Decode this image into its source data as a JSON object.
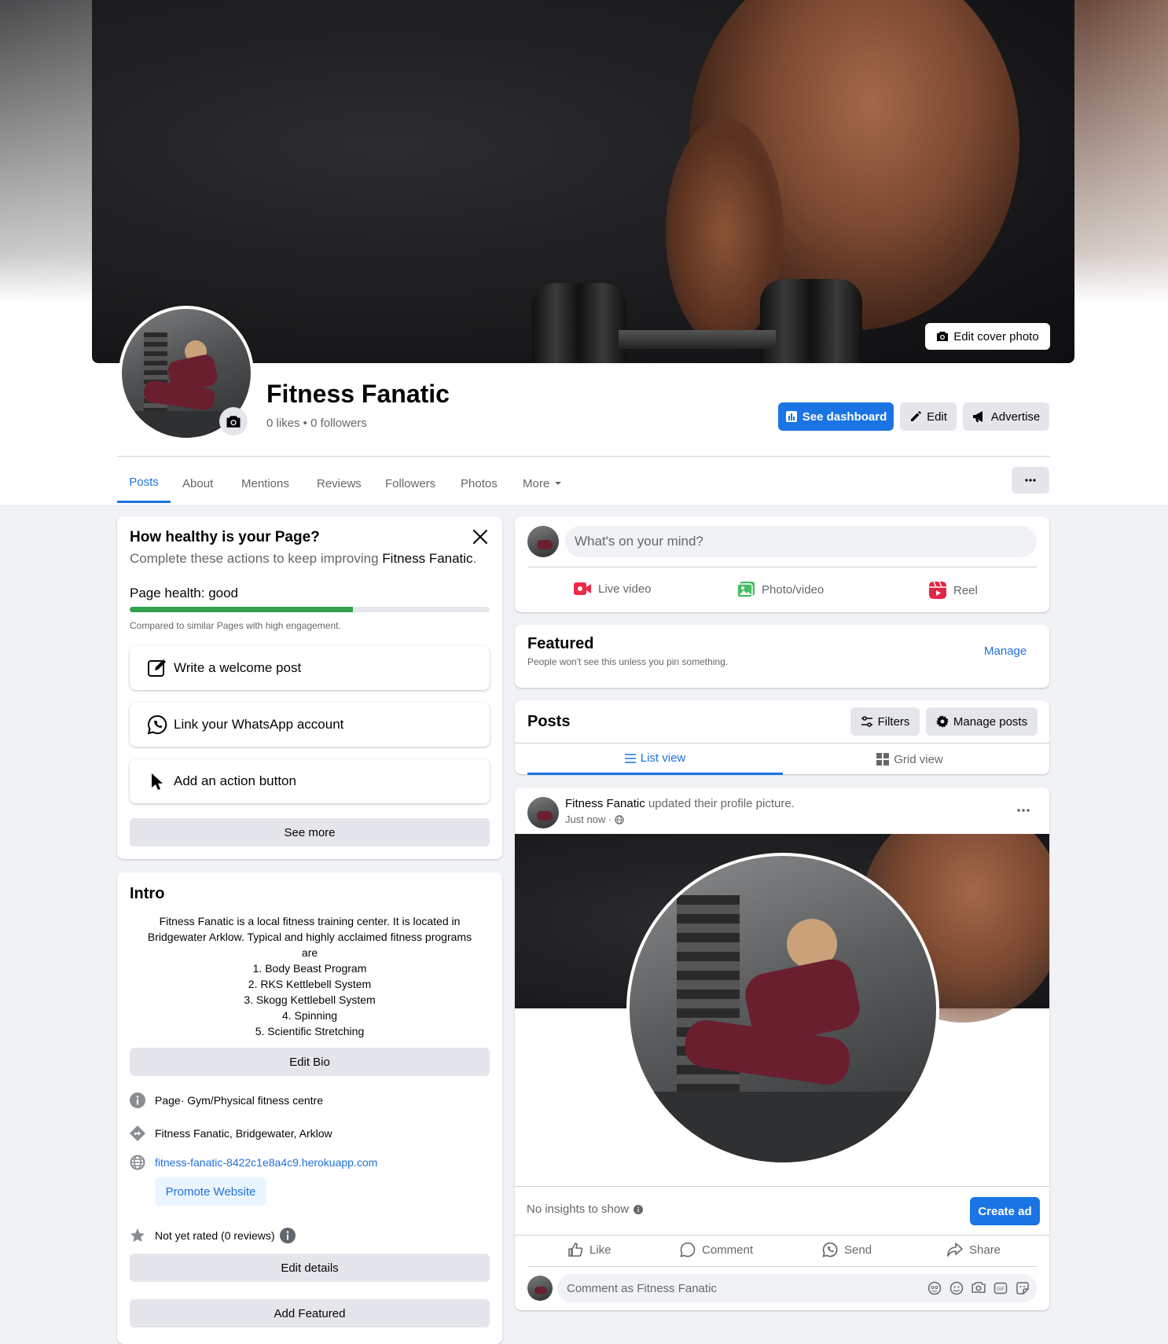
{
  "cover": {
    "edit_label": "Edit cover photo"
  },
  "profile": {
    "name": "Fitness Fanatic",
    "stats": "0 likes • 0 followers"
  },
  "header_buttons": {
    "dashboard": "See dashboard",
    "edit": "Edit",
    "advertise": "Advertise"
  },
  "tabs": [
    {
      "label": "Posts"
    },
    {
      "label": "About"
    },
    {
      "label": "Mentions"
    },
    {
      "label": "Reviews"
    },
    {
      "label": "Followers"
    },
    {
      "label": "Photos"
    },
    {
      "label": "More"
    }
  ],
  "health": {
    "title": "How healthy is your Page?",
    "subtitle_prefix": "Complete these actions to keep improving ",
    "subtitle_name": "Fitness Fanatic",
    "subtitle_suffix": ".",
    "status": "Page health: good",
    "progress": 0.62,
    "compare": "Compared to similar Pages with high engagement.",
    "actions": [
      "Write a welcome post",
      "Link your WhatsApp account",
      "Add an action button"
    ],
    "see_more": "See more"
  },
  "intro": {
    "title": "Intro",
    "bio": [
      "Fitness Fanatic is a local fitness training center. It is located in",
      "Bridgewater Arklow. Typical and highly acclaimed fitness programs",
      "are",
      "1. Body Beast Program",
      "2. RKS Kettlebell System",
      "3. Skogg Kettlebell System",
      "4. Spinning",
      "5. Scientific Stretching"
    ],
    "edit_bio": "Edit Bio",
    "category_prefix": "Page",
    "category": " · Gym/Physical fitness centre",
    "address": "Fitness Fanatic, Bridgewater, Arklow",
    "website": "fitness-fanatic-8422c1e8a4c9.herokuapp.com",
    "promote": "Promote Website",
    "rating": "Not yet rated (0 reviews)",
    "edit_details": "Edit details",
    "add_featured": "Add Featured"
  },
  "composer": {
    "placeholder": "What's on your mind?",
    "live": "Live video",
    "photo": "Photo/video",
    "reel": "Reel"
  },
  "featured": {
    "title": "Featured",
    "subtitle": "People won't see this unless you pin something.",
    "manage": "Manage"
  },
  "posts_header": {
    "title": "Posts",
    "filters": "Filters",
    "manage": "Manage posts",
    "list_view": "List view",
    "grid_view": "Grid view"
  },
  "post": {
    "author": "Fitness Fanatic",
    "action": " updated their profile picture.",
    "time": "Just now ·",
    "insights": "No insights to show",
    "create_ad": "Create ad",
    "like": "Like",
    "comment": "Comment",
    "send": "Send",
    "share": "Share",
    "comment_placeholder": "Comment as Fitness Fanatic"
  },
  "colors": {
    "accent": "#1b74e4",
    "health_bar": "#31a24c",
    "link": "#216fdb"
  }
}
